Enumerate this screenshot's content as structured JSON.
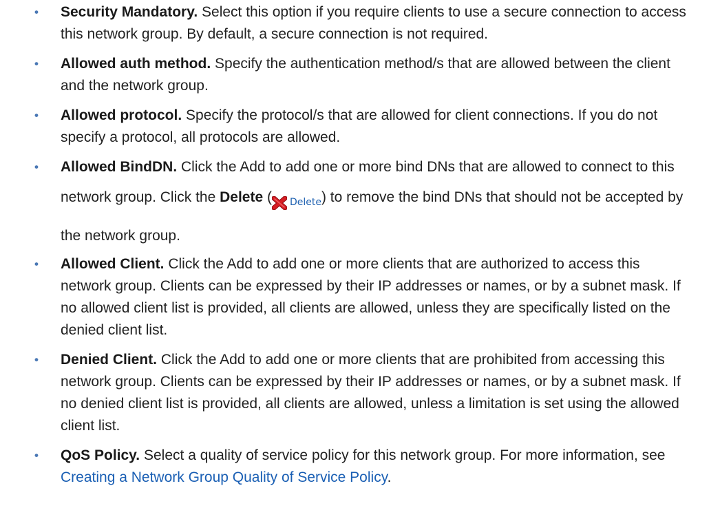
{
  "items": [
    {
      "term": "Security Mandatory.",
      "text": " Select this option if you require clients to use a secure connection to access this network group. By default, a secure connection is not required."
    },
    {
      "term": "Allowed auth method.",
      "text": " Specify the authentication method/s that are allowed between the client and the network group."
    },
    {
      "term": "Allowed protocol.",
      "text": " Specify the protocol/s that are allowed for client connections. If you do not specify a protocol, all protocols are allowed."
    },
    {
      "term": "Allowed BindDN.",
      "text_a": " Click the Add to add one or more bind DNs that are allowed to connect to this network group. Click the ",
      "bold_b": "Delete",
      "text_c": " (",
      "delete_icon_label": "Delete",
      "text_d": ") to remove the bind DNs that should not be accepted by the network group."
    },
    {
      "term": "Allowed Client.",
      "text": " Click the Add to add one or more clients that are authorized to access this network group. Clients can be expressed by their IP addresses or names, or by a subnet mask. If no allowed client list is provided, all clients are allowed, unless they are specifically listed on the denied client list."
    },
    {
      "term": "Denied Client.",
      "text": " Click the Add to add one or more clients that are prohibited from accessing this network group. Clients can be expressed by their IP addresses or names, or by a subnet mask. If no denied client list is provided, all clients are allowed, unless a limitation is set using the allowed client list."
    },
    {
      "term": "QoS Policy.",
      "text": " Select a quality of service policy for this network group. For more information, see ",
      "link": "Creating a Network Group Quality of Service Policy",
      "text_end": "."
    }
  ],
  "colors": {
    "bullet": "#4a78b5",
    "link": "#1a5fb4",
    "delete_x": "#c8151b"
  },
  "icons": {
    "delete": "delete-x-icon"
  }
}
